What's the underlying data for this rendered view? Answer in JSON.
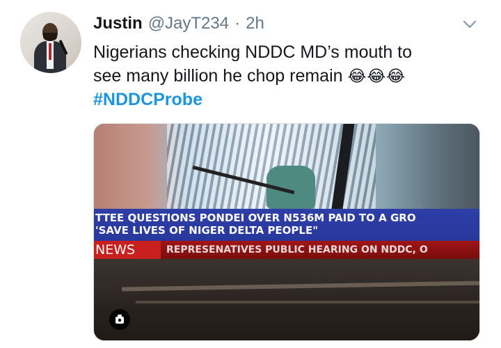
{
  "tweet": {
    "author_name": "Justin",
    "handle": "@JayT234",
    "separator": "·",
    "time": "2h",
    "text_line1": "Nigerians checking NDDC MD’s mouth to",
    "text_line2": "see many billion he chop remain",
    "emojis": "😂😂😂",
    "hashtag": "#NDDCProbe"
  },
  "media": {
    "ticker_line1": "TTEE QUESTIONS PONDEI OVER N536M PAID TO A GRO",
    "ticker_line2": "'SAVE LIVES OF NIGER DELTA PEOPLE\"",
    "news_tag": "NEWS",
    "ticker_line3": "REPRESENATIVES PUBLIC HEARING ON NDDC, O"
  },
  "icons": {
    "caret": "chevron-down-icon",
    "media_badge": "gif-icon"
  },
  "colors": {
    "link": "#1b95e0",
    "secondary_text": "#657786",
    "primary_text": "#14171a"
  }
}
